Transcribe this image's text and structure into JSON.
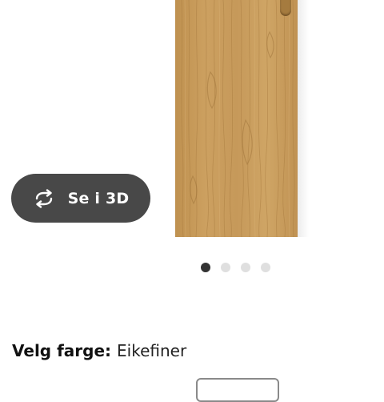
{
  "product_image": {
    "material": "oak veneer",
    "colors": {
      "wood_base": "#c79a5a",
      "wood_grain": "#a97c40",
      "wood_light": "#d8b174"
    }
  },
  "view_3d_button": {
    "label": "Se i 3D",
    "icon": "rotate-3d-icon",
    "background": "#484848"
  },
  "carousel": {
    "total_slides": 4,
    "active_index": 0,
    "active_color": "#333333",
    "inactive_color": "#dfdfdf"
  },
  "color_selector": {
    "label": "Velg farge:",
    "value": "Eikefiner"
  }
}
